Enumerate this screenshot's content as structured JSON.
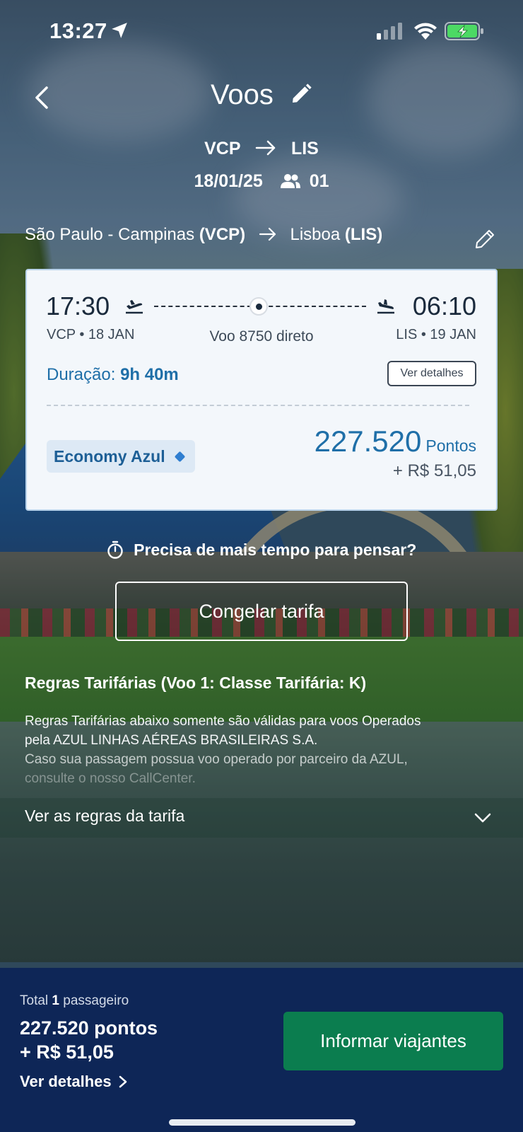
{
  "status_bar": {
    "time": "13:27",
    "icons": [
      "location-arrow-icon",
      "cellular-signal-icon",
      "wifi-icon",
      "battery-charging-icon"
    ]
  },
  "header": {
    "title": "Voos",
    "origin": "VCP",
    "destination": "LIS",
    "date": "18/01/25",
    "passengers": "01"
  },
  "trip": {
    "origin_city": "São Paulo - Campinas",
    "origin_code": "(VCP)",
    "destination_city": "Lisboa",
    "destination_code": "(LIS)"
  },
  "flight": {
    "departure_time": "17:30",
    "arrival_time": "06:10",
    "departure_info": "VCP • 18 JAN",
    "arrival_info": "LIS • 19 JAN",
    "flight_label": "Voo 8750 direto",
    "duration_label": "Duração:",
    "duration_value": "9h 40m",
    "details_button": "Ver detalhes",
    "fare_class": "Economy Azul",
    "points": "227.520",
    "points_unit": "Pontos",
    "cash": "+ R$ 51,05"
  },
  "freeze": {
    "question": "Precisa de mais tempo para pensar?",
    "button": "Congelar tarifa"
  },
  "rules": {
    "title": "Regras Tarifárias (Voo 1: Classe Tarifária: K)",
    "line1": "Regras Tarifárias abaixo somente são válidas para voos Operados",
    "line2": "pela AZUL LINHAS AÉREAS BRASILEIRAS S.A.",
    "line3": "Caso sua passagem possua voo operado por parceiro da AZUL,",
    "line4": "consulte o nosso CallCenter.",
    "toggle": "Ver as regras da tarifa"
  },
  "footer": {
    "total_prefix": "Total",
    "total_count": "1",
    "total_suffix": "passageiro",
    "total_points": "227.520 pontos",
    "total_cash": "+ R$ 51,05",
    "details_link": "Ver detalhes",
    "cta": "Informar viajantes"
  },
  "colors": {
    "brand_blue": "#1f6fa8",
    "footer_bg": "#0e2657",
    "cta_green": "#0b7d4f"
  }
}
